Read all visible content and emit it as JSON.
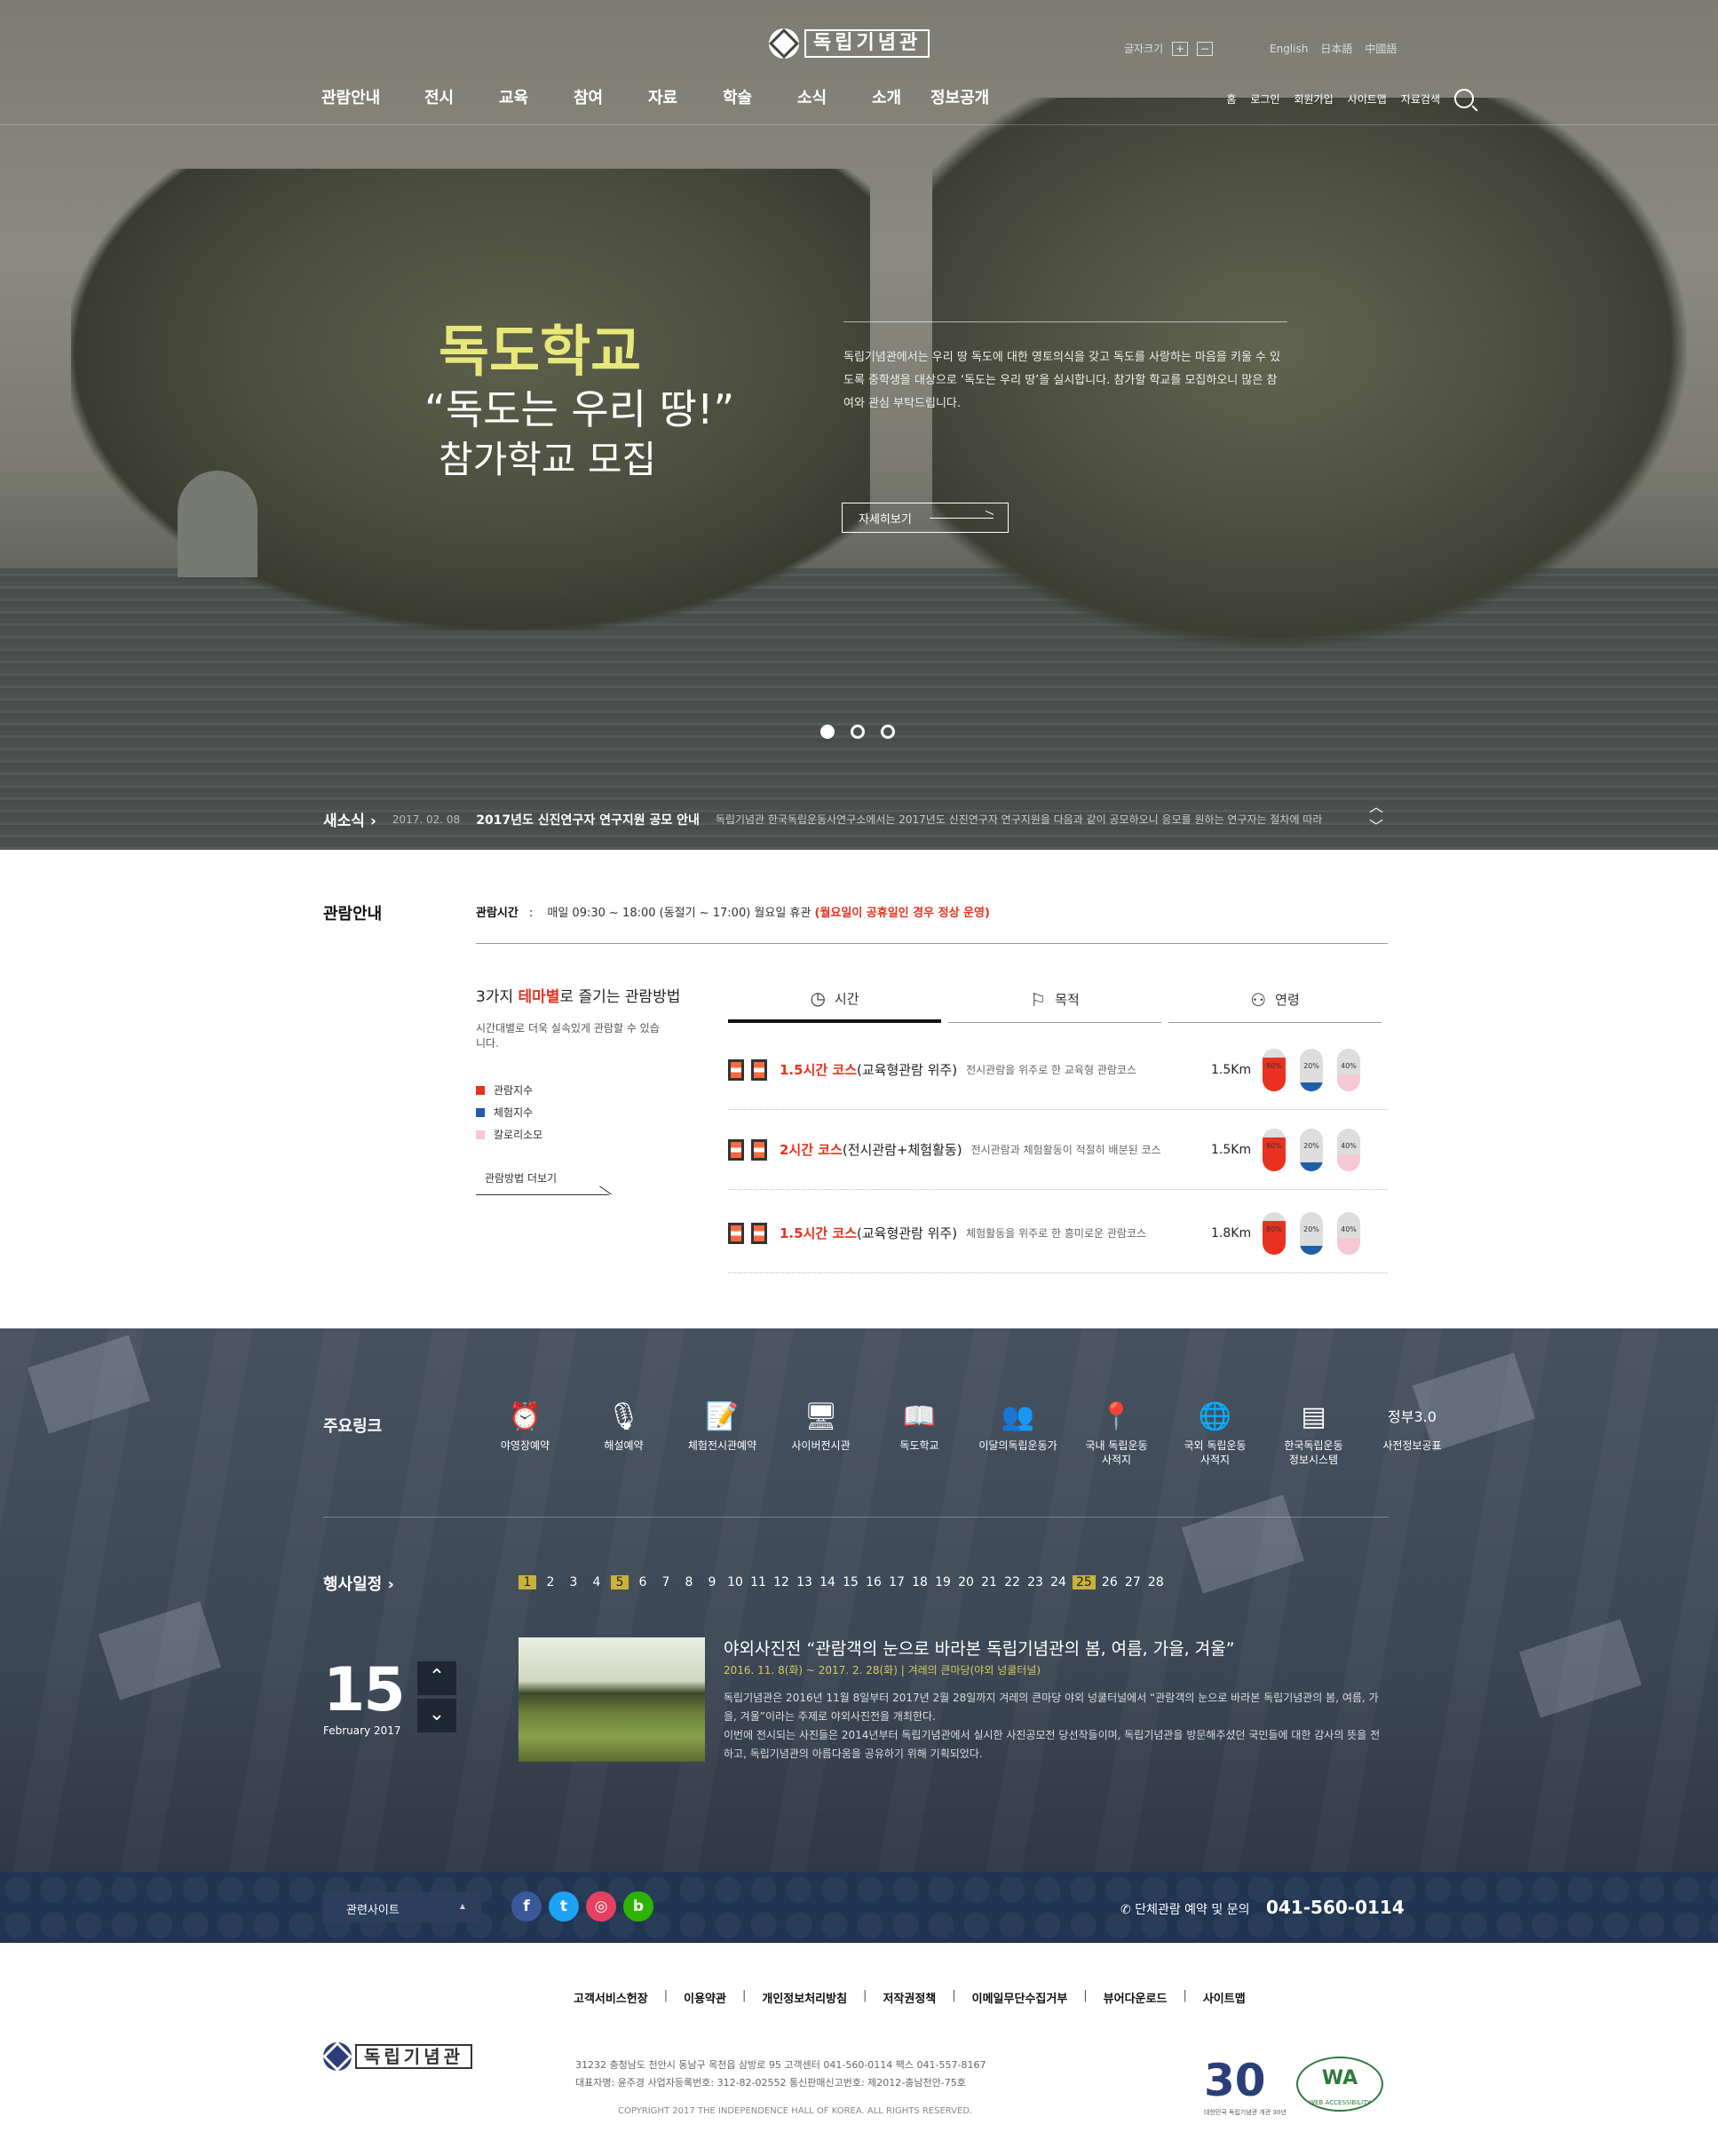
{
  "header": {
    "logo_text": "독립기념관",
    "font_size_label": "글자크기",
    "font_plus": "+",
    "font_minus": "−",
    "languages": [
      "English",
      "日本語",
      "中國語"
    ],
    "gnb": [
      "관람안내",
      "전시",
      "교육",
      "참여",
      "자료",
      "학술",
      "소식",
      "소개",
      "정보공개"
    ],
    "util": [
      "홈",
      "로그인",
      "회원가입",
      "사이트맵",
      "자료검색"
    ]
  },
  "hero": {
    "title": "독도학교",
    "sub1": "“독도는 우리 땅!”",
    "sub2": "참가학교 모집",
    "desc": "독립기념관에서는 우리 땅 독도에 대한 영토의식을 갖고 독도를 사랑하는 마음을 키울 수 있도록 중학생을 대상으로 ‘독도는 우리 땅’을 실시합니다. 참가할 학교를 모집하오니 많은 참여와 관심 부탁드립니다.",
    "more": "자세히보기",
    "slides": 3,
    "active_slide": 1
  },
  "news": {
    "label": "새소식",
    "date": "2017. 02. 08",
    "headline": "2017년도 신진연구자 연구지원 공모 안내",
    "summary": "독립기념관 한국독립운동사연구소에서는 2017년도 신진연구자 연구지원을 다음과 같이 공모하오니 응모를 원하는 연구자는 절차에 따라"
  },
  "visit": {
    "title": "관람안내",
    "hours_label": "관람시간",
    "hours": "매일 09:30 ~ 18:00 (동절기 ~ 17:00)  월요일 휴관",
    "hours_note": "(월요일이 공휴일인 경우 정상 운영)",
    "theme_pre": "3가지 ",
    "theme_red": "테마별",
    "theme_post": "로 즐기는 관람방법",
    "theme_desc": "시간대별로 더욱 실속있게 관람할 수 있습니다.",
    "legend": [
      {
        "label": "관람지수",
        "color": "#e8321f"
      },
      {
        "label": "체험지수",
        "color": "#1f5fa8"
      },
      {
        "label": "칼로리소모",
        "color": "#f6c7d4"
      }
    ],
    "more": "관람방법 더보기",
    "tabs": [
      {
        "label": "시간",
        "icon": "clock-icon"
      },
      {
        "label": "목적",
        "icon": "flag-icon"
      },
      {
        "label": "연령",
        "icon": "user-icon"
      }
    ],
    "courses": [
      {
        "name": "1.5시간 코스",
        "type": "(교육형관람 위주)",
        "desc": "전시관람을 위주로 한 교육형 관람코스",
        "km": "1.5Km",
        "pct": [
          {
            "label": "80%",
            "v": 0.8
          },
          {
            "label": "20%",
            "v": 0.2
          },
          {
            "label": "40%",
            "v": 0.4
          }
        ]
      },
      {
        "name": "2시간 코스",
        "type": "(전시관람+체험활동)",
        "desc": "전시관람과 체험활동이 적절히 배분된 코스",
        "km": "1.5Km",
        "pct": [
          {
            "label": "80%",
            "v": 0.8
          },
          {
            "label": "20%",
            "v": 0.2
          },
          {
            "label": "40%",
            "v": 0.4
          }
        ]
      },
      {
        "name": "1.5시간 코스",
        "type": "(교육형관람 위주)",
        "desc": "체험활동을 위주로 한 흥미로운 관람코스",
        "km": "1.8Km",
        "pct": [
          {
            "label": "80%",
            "v": 0.8
          },
          {
            "label": "20%",
            "v": 0.2
          },
          {
            "label": "40%",
            "v": 0.4
          }
        ]
      }
    ]
  },
  "links": {
    "title": "주요링크",
    "items": [
      {
        "l1": "야영장예약",
        "l2": "",
        "icon": "alarm-clock-icon",
        "g": "⏰"
      },
      {
        "l1": "해설예약",
        "l2": "",
        "icon": "microphone-icon",
        "g": "🎙"
      },
      {
        "l1": "체험전시관예약",
        "l2": "",
        "icon": "edit-document-icon",
        "g": "📝"
      },
      {
        "l1": "사이버전시관",
        "l2": "",
        "icon": "monitor-icon",
        "g": "🖥"
      },
      {
        "l1": "독도학교",
        "l2": "",
        "icon": "book-icon",
        "g": "📖"
      },
      {
        "l1": "이달의독립운동가",
        "l2": "",
        "icon": "people-icon",
        "g": "👥"
      },
      {
        "l1": "국내 독립운동",
        "l2": "사적지",
        "icon": "map-pin-icon",
        "g": "📍"
      },
      {
        "l1": "국외 독립운동",
        "l2": "사적지",
        "icon": "globe-icon",
        "g": "🌐"
      },
      {
        "l1": "한국독립운동",
        "l2": "정보시스템",
        "icon": "layers-icon",
        "g": "▤"
      },
      {
        "l1": "사전정보공표",
        "l2": "",
        "icon": "gov30-icon",
        "g": "정부3.0"
      }
    ]
  },
  "events": {
    "title": "행사일정",
    "days": [
      "1",
      "2",
      "3",
      "4",
      "5",
      "6",
      "7",
      "8",
      "9",
      "10",
      "11",
      "12",
      "13",
      "14",
      "15",
      "16",
      "17",
      "18",
      "19",
      "20",
      "21",
      "22",
      "23",
      "24",
      "25",
      "26",
      "27",
      "28"
    ],
    "highlighted": [
      "1",
      "5",
      "25"
    ],
    "day": "15",
    "month": "February 2017",
    "ev_title": "야외사진전 “관람객의 눈으로 바라본 독립기념관의 봄, 여름, 가을, 겨울”",
    "ev_date": "2016. 11. 8(화) ~ 2017. 2. 28(화)  |  겨레의 큰마당(야외 넝쿨터널)",
    "ev_desc1": "독립기념관은 2016년 11월 8일부터 2017년 2월 28일까지 겨레의 큰마당 야외 넝쿨터널에서 “관람객의 눈으로 바라본 독립기념관의 봄, 여름, 가을, 겨울”이라는 주제로 야외사진전을 개최한다.",
    "ev_desc2": "이번에 전시되는 사진들은 2014년부터 독립기념관에서 실시한 사진공모전 당선작들이며, 독립기념관을 방문해주셨던 국민들에 대한 감사의 뜻을 전하고, 독립기념관의 아름다움을 공유하기 위해 기획되었다."
  },
  "bar": {
    "related": "관련사이트",
    "sns": [
      {
        "name": "facebook-icon",
        "g": "f",
        "c": "#3b5998"
      },
      {
        "name": "twitter-icon",
        "g": "t",
        "c": "#1da1f2"
      },
      {
        "name": "instagram-icon",
        "g": "◎",
        "c": "#e4405f"
      },
      {
        "name": "blog-icon",
        "g": "b",
        "c": "#2db400"
      }
    ],
    "tel_label": "단체관람 예약 및 문의",
    "tel": "041-560-0114"
  },
  "footer": {
    "links": [
      "고객서비스헌장",
      "이용약관",
      "개인정보처리방침",
      "저작권정책",
      "이메일무단수집거부",
      "뷰어다운로드",
      "사이트맵"
    ],
    "info1": "31232   충청남도 천안시 동남구 목천읍 삼방로 95    고객센터 041-560-0114    팩스 041-557-8167",
    "info2": "대표자명: 윤주경    사업자등록번호: 312-82-02552    통신판매신고번호: 제2012-충남천안-75호",
    "copyright": "COPYRIGHT  2017  THE INDEPENDENCE HALL OF KOREA. ALL RIGHTS RESERVED.",
    "badge30": "30",
    "badge30_caption": "대한민국 독립기념관 개관 30년",
    "wa": "WA",
    "wa_caption": "WEB ACCESSIBILITY"
  }
}
